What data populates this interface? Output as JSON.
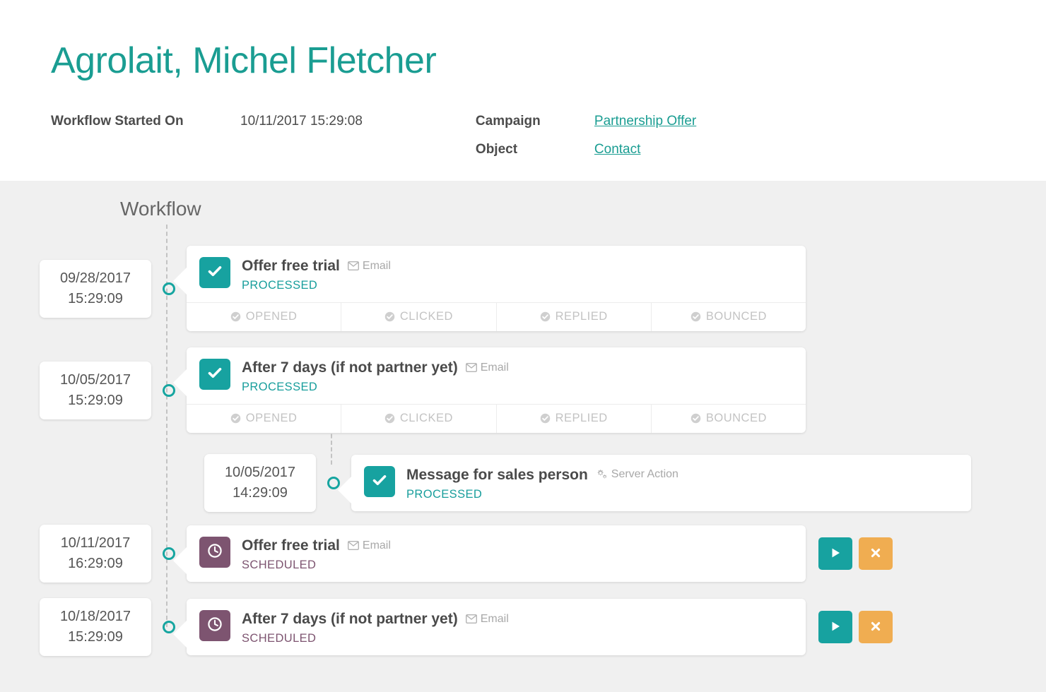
{
  "header": {
    "title": "Agrolait, Michel Fletcher",
    "started_label": "Workflow Started On",
    "started_value": "10/11/2017 15:29:08",
    "campaign_label": "Campaign",
    "campaign_value": "Partnership Offer",
    "object_label": "Object",
    "object_value": "Contact"
  },
  "workflow": {
    "label": "Workflow",
    "stat_labels": [
      "OPENED",
      "CLICKED",
      "REPLIED",
      "BOUNCED"
    ],
    "run_button_label": "Run now",
    "cancel_button_label": "Cancel",
    "rows": [
      {
        "date": "09/28/2017",
        "time": "15:29:09",
        "title": "Offer free trial",
        "type": "Email",
        "type_icon": "envelope-icon",
        "state": "PROCESSED",
        "badge_icon": "check-icon"
      },
      {
        "date": "10/05/2017",
        "time": "15:29:09",
        "title": "After 7 days (if not partner yet)",
        "type": "Email",
        "type_icon": "envelope-icon",
        "state": "PROCESSED",
        "badge_icon": "check-icon"
      },
      {
        "date": "10/05/2017",
        "time": "14:29:09",
        "title": "Message for sales person",
        "type": "Server Action",
        "type_icon": "gears-icon",
        "state": "PROCESSED",
        "badge_icon": "check-icon"
      },
      {
        "date": "10/11/2017",
        "time": "16:29:09",
        "title": "Offer free trial",
        "type": "Email",
        "type_icon": "envelope-icon",
        "state": "SCHEDULED",
        "badge_icon": "clock-icon"
      },
      {
        "date": "10/18/2017",
        "time": "15:29:09",
        "title": "After 7 days (if not partner yet)",
        "type": "Email",
        "type_icon": "envelope-icon",
        "state": "SCHEDULED",
        "badge_icon": "clock-icon"
      }
    ]
  },
  "colors": {
    "teal": "#17a2a0",
    "purple": "#7d5470",
    "orange": "#f0ad51",
    "page_bg": "#f0f0f0"
  }
}
